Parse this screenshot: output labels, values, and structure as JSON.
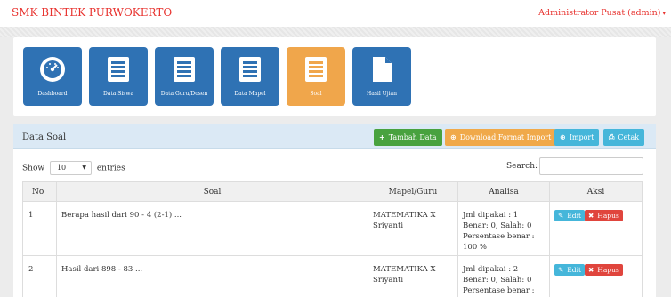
{
  "header": {
    "brand": "SMK BINTEK PURWOKERTO",
    "user": "Administrator Pusat (admin)",
    "user_caret": "▾"
  },
  "menu": [
    {
      "label": "Dashboard",
      "icon": "dashboard-icon"
    },
    {
      "label": "Data Siswa",
      "icon": "list-icon"
    },
    {
      "label": "Data Guru/Dosen",
      "icon": "list-icon"
    },
    {
      "label": "Data Mapel",
      "icon": "list-icon"
    },
    {
      "label": "Soal",
      "icon": "list-icon",
      "active": true
    },
    {
      "label": "Hasil Ujian",
      "icon": "file-icon"
    }
  ],
  "panel": {
    "title": "Data Soal",
    "buttons": {
      "tambah": "Tambah Data",
      "download": "Download Format Import",
      "import": "Import",
      "cetak": "Cetak"
    },
    "icons": {
      "plus": "+",
      "download": "⊕",
      "import": "⊕",
      "print": "⎙"
    }
  },
  "table_controls": {
    "show": "Show",
    "entries_value": "10",
    "entries": "entries",
    "search": "Search:"
  },
  "table": {
    "headers": [
      "No",
      "Soal",
      "Mapel/Guru",
      "Analisa",
      "Aksi"
    ],
    "rows": [
      {
        "no": "1",
        "soal": "Berapa hasil dari 90 - 4 (2-1) ...",
        "mapel": "MATEMATIKA X",
        "guru": "Sriyanti",
        "analisa": [
          "Jml dipakai : 1",
          "Benar: 0, Salah: 0",
          "Persentase benar :",
          "100 %"
        ]
      },
      {
        "no": "2",
        "soal": "Hasil dari 898 - 83 ...",
        "mapel": "MATEMATIKA X",
        "guru": "Sriyanti",
        "analisa": [
          "Jml dipakai : 2",
          "Benar: 0, Salah: 0",
          "Persentase benar :"
        ]
      }
    ],
    "actions": {
      "edit": "Edit",
      "hapus": "Hapus",
      "edit_glyph": "✎",
      "hapus_glyph": "✖"
    }
  },
  "colors": {
    "brand": "#e8332f",
    "tile_blue": "#2f72b4",
    "tile_active": "#f0a64b",
    "btn_green": "#48a23f",
    "btn_orange": "#f0a94a",
    "btn_blue": "#45b6da",
    "btn_red": "#e0453d"
  }
}
